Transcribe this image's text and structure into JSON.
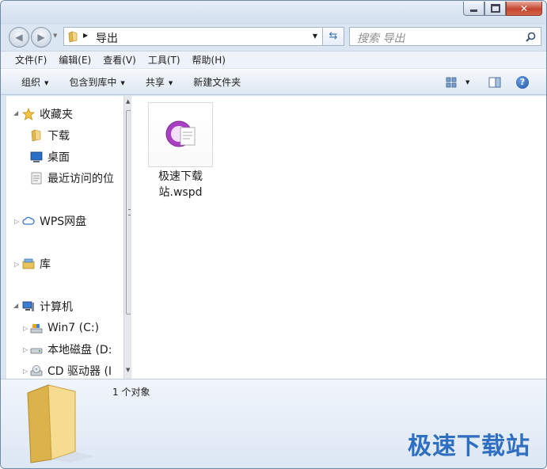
{
  "address": {
    "crumb": "导出"
  },
  "search": {
    "placeholder": "搜索 导出"
  },
  "menu": [
    "文件(F)",
    "编辑(E)",
    "查看(V)",
    "工具(T)",
    "帮助(H)"
  ],
  "toolbar": {
    "organize": "组织",
    "include": "包含到库中",
    "share": "共享",
    "new_folder": "新建文件夹"
  },
  "nav": {
    "favorites": "收藏夹",
    "downloads": "下载",
    "desktop": "桌面",
    "recent": "最近访问的位",
    "wps": "WPS网盘",
    "libraries": "库",
    "computer": "计算机",
    "drive_c": "Win7 (C:)",
    "drive_d": "本地磁盘 (D:",
    "drive_cd": "CD 驱动器 (I"
  },
  "file": {
    "name_line1": "极速下载",
    "name_line2": "站.wspd"
  },
  "status": {
    "count": "1 个对象"
  },
  "watermark": "极速下载站",
  "colors": {
    "accent": "#2e6fc1",
    "file_icon": "#9b3db8"
  }
}
